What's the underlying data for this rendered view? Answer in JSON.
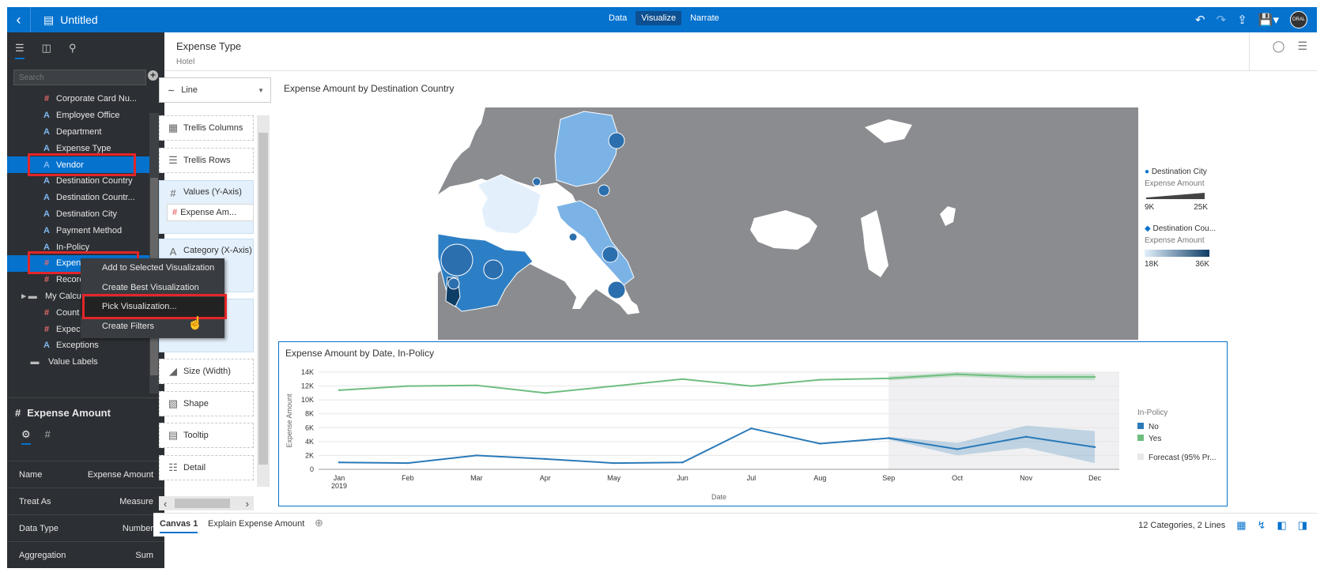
{
  "app": {
    "title": "Untitled",
    "nav_tabs": [
      "Data",
      "Visualize",
      "Narrate"
    ],
    "active_tab": "Visualize",
    "avatar_text": "ORAL"
  },
  "left_panel": {
    "search_placeholder": "Search",
    "tree": [
      {
        "icon": "hash",
        "label": "Corporate Card Nu..."
      },
      {
        "icon": "A",
        "label": "Employee Office"
      },
      {
        "icon": "A",
        "label": "Department"
      },
      {
        "icon": "A",
        "label": "Expense Type"
      },
      {
        "icon": "A",
        "label": "Vendor",
        "selected": true
      },
      {
        "icon": "A",
        "label": "Destination Country"
      },
      {
        "icon": "A",
        "label": "Destination Countr..."
      },
      {
        "icon": "A",
        "label": "Destination City"
      },
      {
        "icon": "A",
        "label": "Payment Method"
      },
      {
        "icon": "A",
        "label": "In-Policy"
      },
      {
        "icon": "hash",
        "label": "Expense Amount",
        "selected": true
      },
      {
        "icon": "hash",
        "label": "Record C"
      },
      {
        "icon": "folder",
        "label": "My Calculat"
      },
      {
        "icon": "hash",
        "label": "Count"
      },
      {
        "icon": "hash",
        "label": "Expecte"
      },
      {
        "icon": "A",
        "label": "Exceptions"
      },
      {
        "icon": "tag",
        "label": "Value Labels"
      }
    ]
  },
  "context_menu": {
    "items": [
      "Add to Selected Visualization",
      "Create Best Visualization",
      "Pick Visualization...",
      "Create Filters"
    ],
    "highlighted": "Pick Visualization..."
  },
  "properties": {
    "title": "Expense Amount",
    "rows": [
      {
        "name": "Name",
        "value": "Expense Amount"
      },
      {
        "name": "Treat As",
        "value": "Measure"
      },
      {
        "name": "Data Type",
        "value": "Number"
      },
      {
        "name": "Aggregation",
        "value": "Sum"
      }
    ]
  },
  "header": {
    "title": "Expense Type",
    "subtitle": "Hotel"
  },
  "grammar": {
    "viz_type": "Line",
    "boxes": [
      "Trellis Columns",
      "Trellis Rows",
      "Values (Y-Axis)",
      "Category (X-Axis)",
      "Size (Width)",
      "Shape",
      "Tooltip",
      "Detail"
    ],
    "values_pill": "Expense Am..."
  },
  "map_viz": {
    "title": "Expense Amount by Destination Country",
    "legend": {
      "city_title": "Destination City",
      "city_measure": "Expense Amount",
      "city_min": "9K",
      "city_max": "25K",
      "country_title": "Destination Cou...",
      "country_measure": "Expense Amount",
      "country_min": "18K",
      "country_max": "36K"
    },
    "colors": {
      "land": "#8a8c8f",
      "country_light": "#e3f0fc",
      "country_mid": "#7bb3e6",
      "country_dark": "#2d7fc5",
      "bubble": "#2c6fae"
    }
  },
  "line_viz": {
    "title": "Expense Amount by Date, In-Policy",
    "chart_data": {
      "type": "line",
      "title": "Expense Amount by Date, In-Policy",
      "xlabel": "Date",
      "ylabel": "Expense Amount",
      "x": [
        "Jan",
        "Feb",
        "Mar",
        "Apr",
        "May",
        "Jun",
        "Jul",
        "Aug",
        "Sep",
        "Oct",
        "Nov",
        "Dec"
      ],
      "x_year": "2019",
      "ylim": [
        0,
        14000
      ],
      "yticks": [
        "0",
        "2K",
        "4K",
        "6K",
        "8K",
        "10K",
        "12K",
        "14K"
      ],
      "series": [
        {
          "name": "No",
          "color": "#2a7ab8",
          "values": [
            1000,
            900,
            2000,
            1500,
            900,
            1000,
            5900,
            3700,
            4500,
            2900,
            4700,
            3200
          ]
        },
        {
          "name": "Yes",
          "color": "#6ebe7f",
          "values": [
            11400,
            12000,
            12100,
            11000,
            12000,
            13000,
            12000,
            12900,
            13100,
            13700,
            13300,
            13300
          ]
        }
      ],
      "forecast_start": "Sep",
      "legend_title": "In-Policy",
      "legend_forecast": "Forecast (95% Pr..."
    }
  },
  "footer": {
    "tabs": [
      "Canvas 1",
      "Explain Expense Amount"
    ],
    "status": "12 Categories, 2 Lines"
  }
}
